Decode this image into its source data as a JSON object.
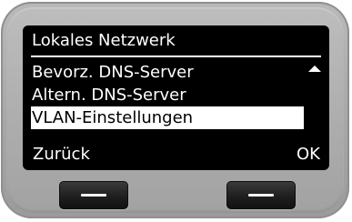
{
  "screen": {
    "title": "Lokales Netzwerk",
    "menu_items": [
      {
        "label": "Bevorz. DNS-Server",
        "selected": false
      },
      {
        "label": "Altern. DNS-Server",
        "selected": false
      },
      {
        "label": "VLAN-Einstellungen",
        "selected": true
      }
    ],
    "scroll_indicator": "scroll-up-arrow-icon",
    "softkeys": {
      "left_label": "Zurück",
      "right_label": "OK"
    }
  },
  "colors": {
    "screen_background": "#000000",
    "text": "#ffffff",
    "selection_background": "#ffffff",
    "selection_text": "#000000",
    "device_body": "#acacac",
    "hardware_button": "#1f1f1f"
  }
}
